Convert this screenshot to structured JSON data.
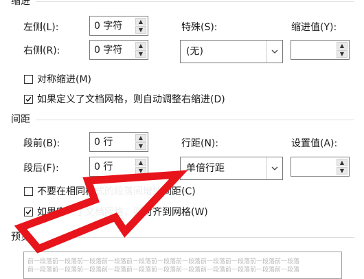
{
  "indent": {
    "section_title": "缩进",
    "left": {
      "label": "左侧(L):",
      "value": "0 字符"
    },
    "right": {
      "label": "右侧(R):",
      "value": "0 字符"
    },
    "special": {
      "label": "特殊(S):",
      "value": "(无)"
    },
    "indent_value": {
      "label": "缩进值(Y):",
      "value": ""
    },
    "mirror_indents": {
      "label": "对称缩进(M)",
      "checked": false
    },
    "auto_adjust_right": {
      "label": "如果定义了文档网格，则自动调整右缩进(D)",
      "checked": true
    }
  },
  "spacing": {
    "section_title": "间距",
    "before": {
      "label": "段前(B):",
      "value": "0 行"
    },
    "after": {
      "label": "段后(F):",
      "value": "0 行"
    },
    "line_spacing": {
      "label": "行距(N):",
      "value": "单倍行距"
    },
    "set_value": {
      "label": "设置值(A):",
      "value": ""
    },
    "no_space_same_style": {
      "label": "不要在相同样式的段落间增加间距(C)",
      "checked": false
    },
    "snap_to_grid": {
      "label": "如果定义了文档网格，则对齐到网格(W)",
      "checked": true
    }
  },
  "preview": {
    "section_title": "预览",
    "sample_line": "前一段落前一段落前一段落前一段落前一段落前一段落前一段落前一段落前一段落前一段落前一段落"
  },
  "annotation": {
    "color": "#e8141b",
    "icon": "red-arrow-icon"
  }
}
